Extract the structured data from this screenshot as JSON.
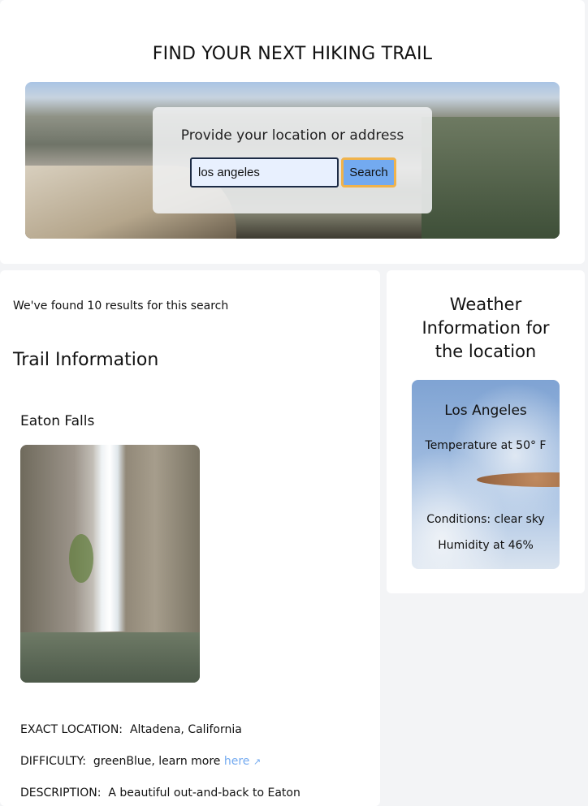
{
  "header": {
    "title": "FIND YOUR NEXT HIKING TRAIL",
    "prompt": "Provide your location or address",
    "search_value": "los angeles",
    "search_label": "Search"
  },
  "results": {
    "count_text": "We've found 10 results for this search",
    "section_title": "Trail Information",
    "trail": {
      "name": "Eaton Falls",
      "location_label": "EXACT LOCATION:",
      "location": "Altadena, California",
      "difficulty_label": "DIFFICULTY:",
      "difficulty": "greenBlue, learn more",
      "link": "here",
      "description_label": "DESCRIPTION:",
      "description": "A beautiful out-and-back to Eaton"
    }
  },
  "weather": {
    "title": "Weather Information for the location",
    "city": "Los Angeles",
    "temperature": "Temperature at 50° F",
    "icon": "clear-sky-icon",
    "conditions": "Conditions: clear sky",
    "humidity": "Humidity at 46%"
  }
}
